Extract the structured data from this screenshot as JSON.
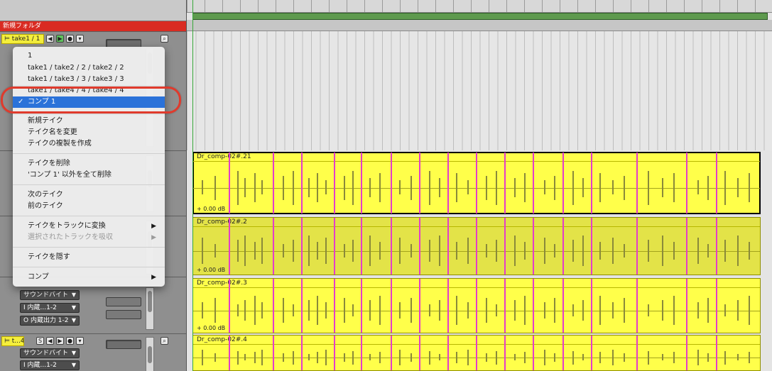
{
  "folder": {
    "label": "新規フォルダ"
  },
  "tracks": [
    {
      "take_label": "take1 / 1",
      "sound_device": "",
      "input": "",
      "output": ""
    },
    {
      "take_label": "t...4",
      "sound_device": "サウンドバイト",
      "input": "I 内蔵...1-2",
      "output": ""
    }
  ],
  "track3_fields": {
    "sound_device": "サウンドバイト",
    "input": "I 内蔵...1-2",
    "output": "O 内蔵出力 1-2"
  },
  "regions": [
    {
      "name": "Dr_comp-02#.21",
      "gain": "+ 0.00 dB"
    },
    {
      "name": "Dr_comp-02#.2",
      "gain": "+ 0.00 dB"
    },
    {
      "name": "Dr_comp-02#.3",
      "gain": "+ 0.00 dB"
    },
    {
      "name": "Dr_comp-02#.4",
      "gain": ""
    }
  ],
  "menu": {
    "takes": [
      {
        "label": "1"
      },
      {
        "label": "take1 / take2 / 2 / take2 / 2"
      },
      {
        "label": "take1 / take3 / 3 / take3 / 3"
      },
      {
        "label": "take1 / take4 / 4 / take4 / 4"
      }
    ],
    "current_comp": {
      "check": "✓",
      "label": "コンプ 1"
    },
    "items_group1": [
      "新規テイク",
      "テイク名を変更",
      "テイクの複製を作成"
    ],
    "items_group2": [
      "テイクを削除",
      "'コンプ 1' 以外を全て削除"
    ],
    "items_group3": [
      "次のテイク",
      "前のテイク"
    ],
    "convert_label": "テイクをトラックに変換",
    "absorb_label": "選択されたトラックを吸収",
    "hide_label": "テイクを隠す",
    "comp_label": "コンプ",
    "submenu_arrow": "▶"
  },
  "colors": {
    "folder_bar": "#d92b22",
    "take_label": "#f5ef3c",
    "region": "#ffff4a",
    "comp_marker": "#e23ec9",
    "menu_selection": "#2b72d9",
    "highlight_ring": "#e03a2c",
    "playhead": "#38a83a"
  },
  "icons": [
    "take-folder-icon",
    "play-icon",
    "record-icon",
    "chevron-down-icon",
    "solo-icon",
    "zoom-icon",
    "submenu-arrow-icon"
  ]
}
